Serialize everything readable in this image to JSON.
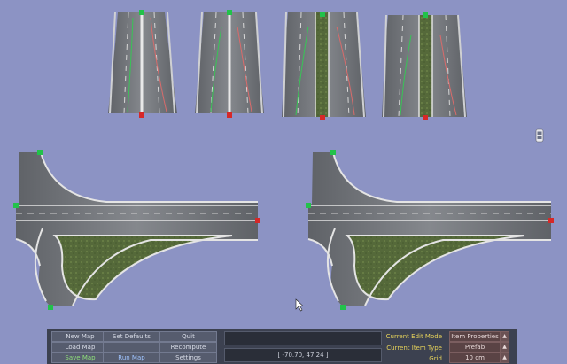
{
  "toolbar": {
    "new_map": "New Map",
    "load_map": "Load Map",
    "save_map": "Save Map",
    "set_defaults": "Set Defaults",
    "recompute": "Recompute",
    "run_map": "Run Map",
    "quit": "Quit",
    "settings": "Settings"
  },
  "status": {
    "coordinates": "[ -70.70, 47.24 ]"
  },
  "properties": {
    "edit_mode_label": "Current Edit Mode",
    "edit_mode_value": "Item Properties",
    "item_type_label": "Current Item Type",
    "item_type_value": "Prefab",
    "grid_label": "Grid",
    "grid_value": "10 cm"
  },
  "icons": {
    "spin_up": "up-triangle-icon",
    "car": "car-icon",
    "cursor": "mouse-cursor-icon"
  },
  "colors": {
    "background": "#8c93c4",
    "asphalt": "#7a7d82",
    "grass": "#556b38",
    "start_node": "#22c24a",
    "end_node": "#d62828"
  }
}
